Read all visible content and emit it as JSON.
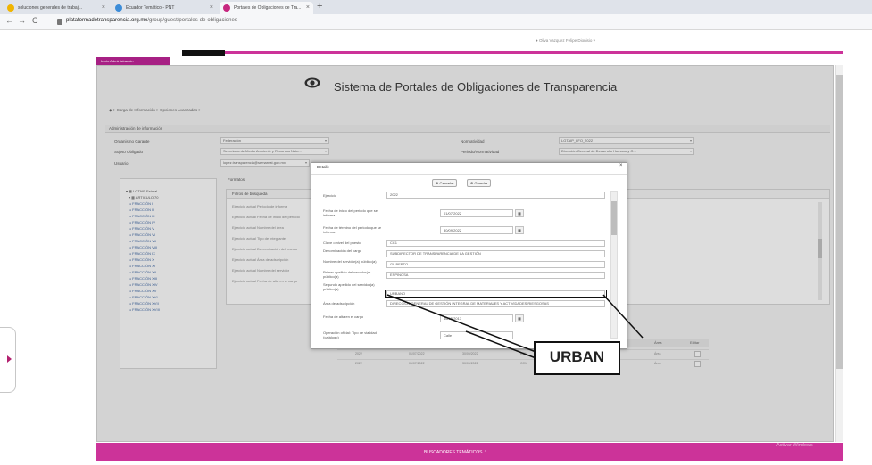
{
  "browser": {
    "tabs": [
      {
        "label": "soluciones generales de trabaj...",
        "favicon_color": "#f0b400"
      },
      {
        "label": "Ecuador Temático - PNT",
        "favicon_color": "#3c8cd8"
      },
      {
        "label": "Portales de Obligaciones de Tra...",
        "favicon_color": "#c7277f",
        "active": true
      }
    ],
    "url_host": "plataformadetransparencia.org.mx",
    "url_path": "/group/guest/portales-de-obligaciones"
  },
  "page": {
    "user_line": "● Oliva Vazquez Felipe Dionisio ▾",
    "top_tab_label": "Inicio    Administración",
    "title": "Sistema de Portales de Obligaciones de Transparencia",
    "breadcrumb": "◆  > Carga de Información  >  Opciones Avanzadas  >",
    "section_header": "Administración de información",
    "form": [
      {
        "label": "Organismo Garante",
        "value": "Federación"
      },
      {
        "label": "Sujeto Obligado",
        "value": "Secretaría de Medio Ambiente y Recursos Natu..."
      },
      {
        "label": "Usuario",
        "value": "lopez.transparencia@semarnat.gob.mx"
      }
    ],
    "form_right": [
      {
        "label": "Normatividad",
        "value": "LGTAIP_LFO_2022"
      },
      {
        "label": "Periodo/Normatividad",
        "value": "Dirección General de Desarrollo Humano y O..."
      }
    ],
    "documents_label": "Formatos",
    "tree_root": "▾ ▦ LGTAIP Estatal",
    "tree_sub": "▾ ▦ ARTICULO 70",
    "tree_items": [
      "FRACCIÓN I",
      "FRACCIÓN II",
      "FRACCIÓN III",
      "FRACCIÓN IV",
      "FRACCIÓN V",
      "FRACCIÓN VI",
      "FRACCIÓN VII",
      "FRACCIÓN VIII",
      "FRACCIÓN IX",
      "FRACCIÓN X",
      "FRACCIÓN XI",
      "FRACCIÓN XII",
      "FRACCIÓN XIII",
      "FRACCIÓN XIV",
      "FRACCIÓN XV",
      "FRACCIÓN XVI",
      "FRACCIÓN XVII",
      "FRACCIÓN XVIII"
    ],
    "panel_header": "Filtros de búsqueda",
    "panel_rows": [
      "Ejercicio actual  Periodo de informe",
      "Ejercicio actual  Fecha de inicio del periodo",
      "Ejercicio actual  Nombre del área",
      "Ejercicio actual  Tipo de integrante",
      "Ejercicio actual  Denominación del puesto",
      "Ejercicio actual  Área de adscripción",
      "Ejercicio actual  Nombre del servidor",
      "Ejercicio actual  Fecha de alta en el cargo"
    ],
    "result_headers": [
      "Ejercicio",
      "Fecha de inicio",
      "Fecha de término",
      "Clave",
      "Denominación",
      "Área",
      "Editar"
    ],
    "result_rows": [
      [
        "2022",
        "01/07/2022",
        "30/09/2022",
        "CC1",
        "Subdirector",
        "Área",
        ""
      ],
      [
        "2022",
        "01/07/2022",
        "30/09/2022",
        "CC1",
        "Subdirector",
        "Área",
        ""
      ]
    ],
    "footer_label": "BUSCADORES TEMÁTICOS  ⌃",
    "watermark": "Activar Windows"
  },
  "modal": {
    "title": "Detalle",
    "close_icon": "×",
    "cancel_label": "⊗ Cancelar",
    "save_label": "⊕ Guardar",
    "fields": [
      {
        "label": "Ejercicio",
        "value": "2022",
        "kind": "text"
      },
      {
        "label": "Fecha de inicio del periodo que se informa",
        "value": "01/07/2022",
        "kind": "date"
      },
      {
        "label": "Fecha de término del periodo que se informa",
        "value": "30/09/2022",
        "kind": "date"
      },
      {
        "label": "Clave o nivel del puesto",
        "value": "CC1",
        "kind": "text"
      },
      {
        "label": "Denominación del cargo",
        "value": "SUBDIRECTOR DE TRANSPARENCIA DE LA GESTIÓN",
        "kind": "text"
      },
      {
        "label": "Nombre del servidor(a) público(a)",
        "value": "GILBERTO",
        "kind": "text"
      },
      {
        "label": "Primer apellido del servidor(a) público(a)",
        "value": "ESPINOSA",
        "kind": "text"
      },
      {
        "label": "Segundo apellido del servidor(a) público(a)",
        "value": "URBANO",
        "kind": "text"
      },
      {
        "label": "Área de adscripción",
        "value": "DIRECCIÓN GENERAL DE GESTIÓN INTEGRAL DE MATERIALES Y ACTIVIDADES RIESGOSAS",
        "kind": "text"
      },
      {
        "label": "Fecha de alta en el cargo",
        "value": "16/05/2017",
        "kind": "date"
      },
      {
        "label": "Operación oficial: Tipo de vialidad (catálogo)",
        "value": "Calle",
        "kind": "select"
      }
    ]
  },
  "annotation": {
    "callout_text": "URBAN"
  },
  "icons": {
    "eye": "eye-icon",
    "back": "←",
    "forward": "→",
    "reload": "C",
    "calendar": "▦"
  }
}
